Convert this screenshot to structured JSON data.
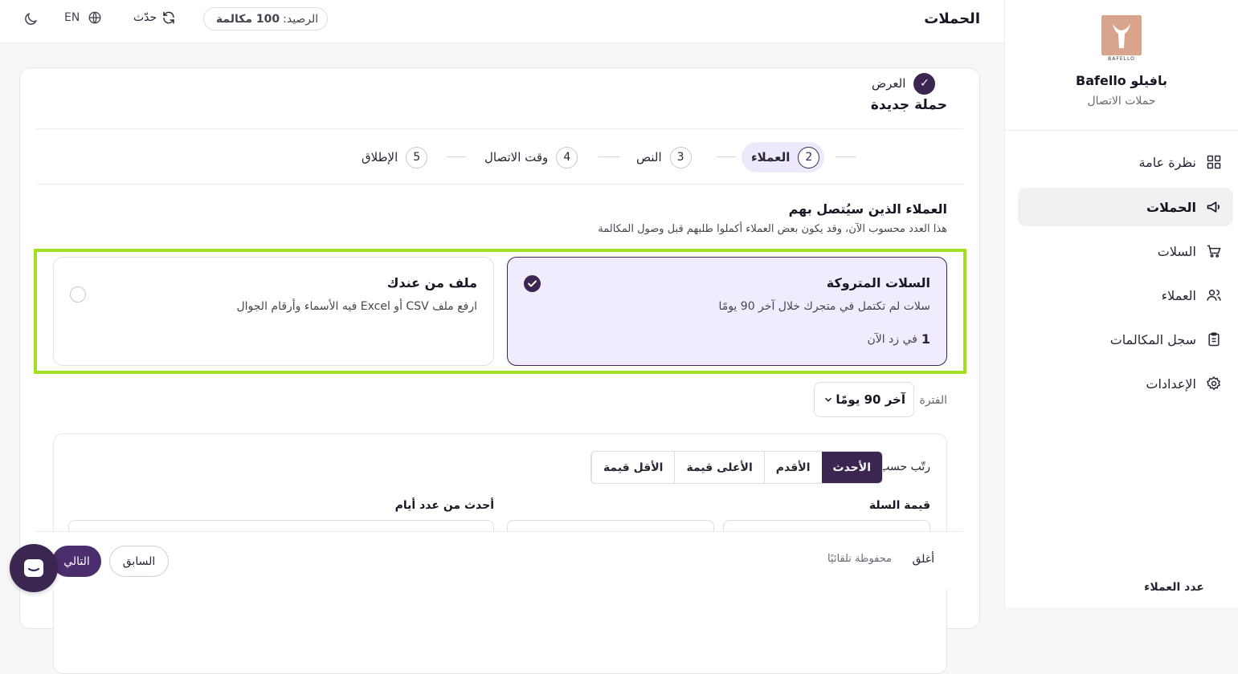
{
  "brand": {
    "name": "Bafello بافيلو",
    "subtitle": "حملات الاتصال",
    "logo_text": "BAFELLO"
  },
  "sidebar": {
    "items": [
      {
        "label": "نظرة عامة",
        "icon": "grid-icon",
        "active": false
      },
      {
        "label": "الحملات",
        "icon": "megaphone-icon",
        "active": true
      },
      {
        "label": "السلات",
        "icon": "cart-icon",
        "active": false
      },
      {
        "label": "العملاء",
        "icon": "users-icon",
        "active": false
      },
      {
        "label": "سجل المكالمات",
        "icon": "clipboard-icon",
        "active": false
      },
      {
        "label": "الإعدادات",
        "icon": "gear-icon",
        "active": false
      }
    ]
  },
  "topbar": {
    "title": "الحملات",
    "balance_label": "الرصيد:",
    "balance_value": "100 مكالمة",
    "refresh_label": "حدّث",
    "lang_label": "EN"
  },
  "campaign": {
    "title": "حملة جديدة",
    "steps": [
      {
        "num": "✓",
        "label": "العرض",
        "state": "done"
      },
      {
        "num": "2",
        "label": "العملاء",
        "state": "current"
      },
      {
        "num": "3",
        "label": "النص",
        "state": "todo"
      },
      {
        "num": "4",
        "label": "وقت الاتصال",
        "state": "todo"
      },
      {
        "num": "5",
        "label": "الإطلاق",
        "state": "todo"
      }
    ],
    "section_title": "العملاء الذين سيُتصل بهم",
    "section_sub": "هذا العدد محسوب الآن، وقد يكون بعض العملاء أكملوا طلبهم قبل وصول المكالمة",
    "options": [
      {
        "title": "السلات المتروكة",
        "desc": "سلات لم تكتمل في متجرك خلال آخر 90 يومًا",
        "count": "1",
        "count_label": "في زد الآن",
        "selected": true
      },
      {
        "title": "ملف من عندك",
        "desc": "ارفع ملف CSV أو Excel فيه الأسماء وأرقام الجوال",
        "selected": false
      }
    ],
    "period_label": "الفترة",
    "period_value": "آخر 90 يومًا",
    "sort_label": "رتّب حسب",
    "sort_options": [
      "الأحدث",
      "الأقدم",
      "الأعلى قيمة",
      "الأقل قيمة"
    ],
    "sort_selected": "الأحدث",
    "field_cart_value": "قيمة السلة",
    "field_newer_than": "أحدث من عدد أيام",
    "field_customer_count": "عدد العملاء"
  },
  "footer": {
    "close_label": "أغلق",
    "autosave_label": "محفوظة تلقائيًا",
    "prev_label": "السابق",
    "next_label": "التالي"
  }
}
